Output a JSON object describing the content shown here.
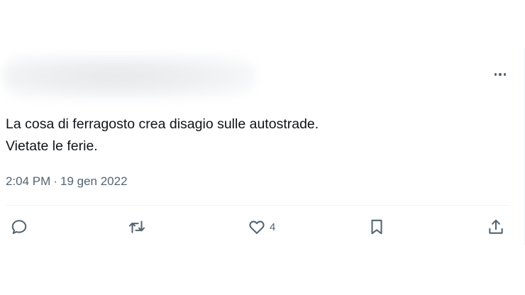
{
  "tweet": {
    "lines": [
      "La cosa di ferragosto crea disagio sulle autostrade.",
      "Vietate le ferie."
    ],
    "time": "2:04 PM",
    "separator": "·",
    "date": "19 gen 2022"
  },
  "actions": {
    "reply": {
      "icon": "reply-icon"
    },
    "retweet": {
      "icon": "retweet-icon"
    },
    "like": {
      "icon": "heart-icon",
      "count": "4"
    },
    "bookmark": {
      "icon": "bookmark-icon"
    },
    "share": {
      "icon": "share-icon"
    }
  },
  "more_menu": {
    "icon": "more-options-icon"
  },
  "colors": {
    "text": "#0f1419",
    "secondary": "#536471",
    "divider": "#eff3f4"
  }
}
